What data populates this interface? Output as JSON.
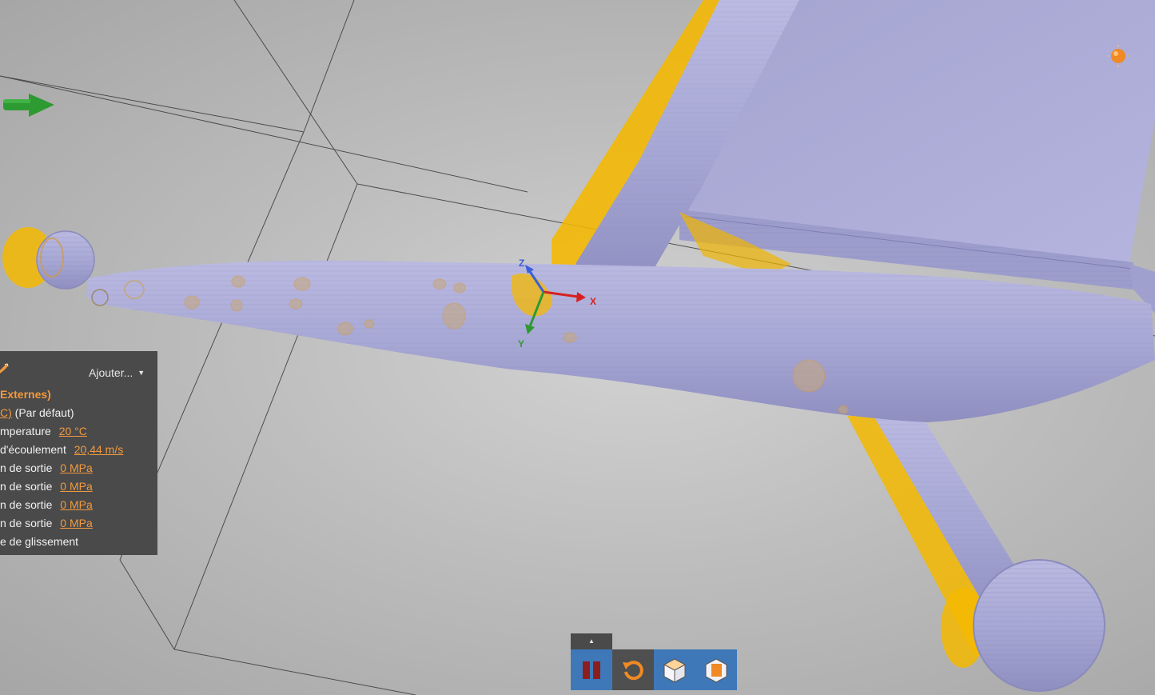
{
  "scene": {
    "axes": {
      "x_label": "X",
      "y_label": "Y",
      "z_label": "Z"
    },
    "mesh_color": "#a6a6d4",
    "highlight_color": "#f5b800",
    "icons": [
      "direction-arrow-icon",
      "light-source-icon",
      "axis-triad-icon"
    ]
  },
  "panel": {
    "add_label": "Ajouter...",
    "title": "Externes)",
    "default_prefix": "C)",
    "default_label": "(Par défaut)",
    "rows": [
      {
        "label": "mperature",
        "value": "20 °C"
      },
      {
        "label": "d'écoulement",
        "value": "20,44 m/s"
      },
      {
        "label": "n de sortie",
        "value": "0 MPa"
      },
      {
        "label": "n de sortie",
        "value": "0 MPa"
      },
      {
        "label": "n de sortie",
        "value": "0 MPa"
      },
      {
        "label": "n de sortie",
        "value": "0 MPa"
      }
    ],
    "last_row": "e de glissement"
  },
  "toolbar": {
    "expand_symbol": "▲",
    "buttons": [
      "pause-icon",
      "reset-icon",
      "solid-view-icon",
      "section-view-icon"
    ],
    "colors": {
      "blue": "#3f78b8",
      "grey": "#4f4f4f",
      "orange": "#f08a24",
      "dark_red": "#8b1f1f"
    }
  }
}
